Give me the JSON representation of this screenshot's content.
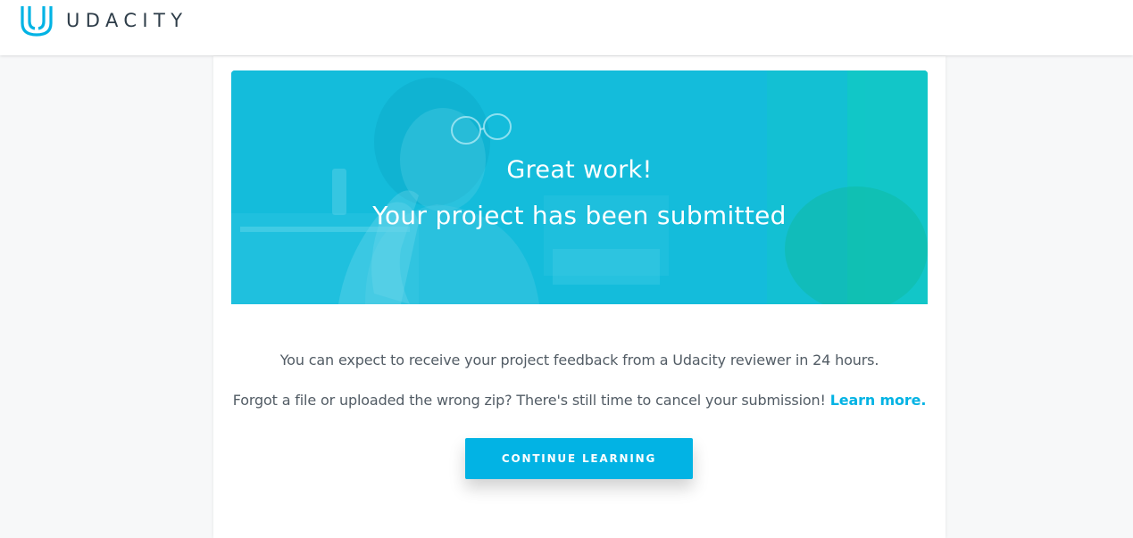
{
  "header": {
    "brand": "UDACITY",
    "logo_icon": "udacity-u-logo-icon",
    "brand_color": "#02b3e4"
  },
  "hero": {
    "line1": "Great work!",
    "line2": "Your project has been submitted"
  },
  "content": {
    "message1": "You can expect to receive your project feedback from a Udacity reviewer in 24 hours.",
    "message2": "Forgot a file or uploaded the wrong zip? There's still time to cancel your submission!",
    "learn_more_link": "Learn more."
  },
  "actions": {
    "continue_label": "CONTINUE LEARNING"
  },
  "colors": {
    "accent": "#02b3e4",
    "text": "#525c65",
    "heading_dark": "#2e3d49",
    "background": "#f7f8f9"
  }
}
